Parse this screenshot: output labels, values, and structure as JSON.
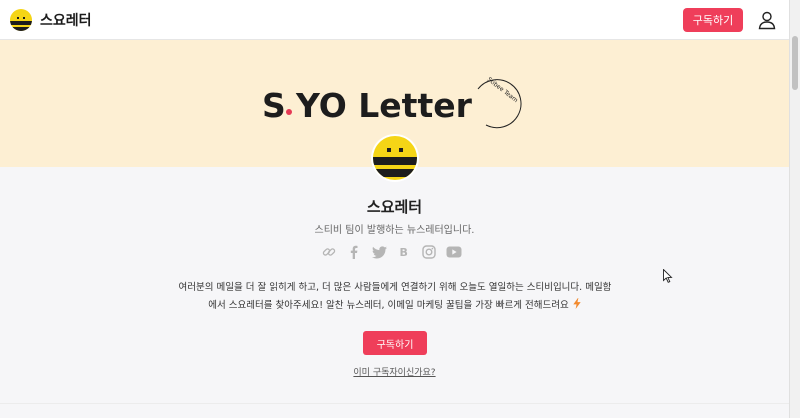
{
  "header": {
    "brand_name": "스요레터",
    "subscribe_label": "구독하기"
  },
  "hero": {
    "logo_text_s": "S",
    "logo_text_main": "YO Letter",
    "tagline": "Stibee Team",
    "background_color": "#fdefd3"
  },
  "profile": {
    "title": "스요레터",
    "subtitle": "스티비 팀이 발행하는 뉴스레터입니다.",
    "socials": [
      "link-icon",
      "facebook-icon",
      "twitter-icon",
      "blog-icon",
      "instagram-icon",
      "youtube-icon"
    ],
    "description_line1": "여러분의 메일을 더 잘 읽히게 하고, 더 많은 사람들에게 연결하기 위해 오늘도 열일하는 스티비입니다. 메일함",
    "description_line2": "에서 스요레터를 찾아주세요! 알찬 뉴스레터, 이메일 마케팅 꿀팁을 가장 빠르게 전해드려요",
    "subscribe_label": "구독하기",
    "already_label": "이미 구독자이신가요?"
  },
  "colors": {
    "accent": "#ef3e5a",
    "page_bg": "#f6f6f8"
  }
}
